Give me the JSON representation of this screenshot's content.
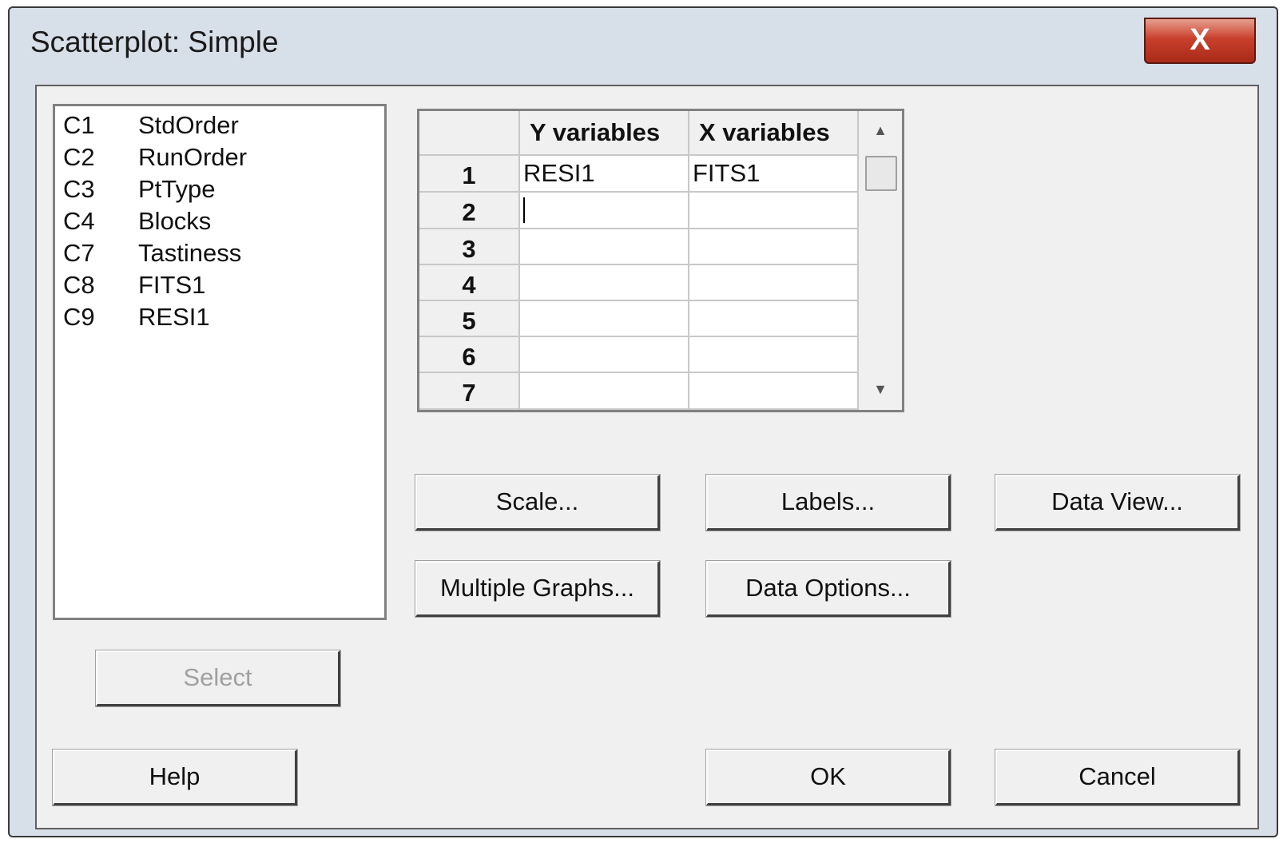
{
  "window": {
    "title": "Scatterplot: Simple",
    "close_label": "X"
  },
  "variables": [
    {
      "col": "C1",
      "name": "StdOrder"
    },
    {
      "col": "C2",
      "name": "RunOrder"
    },
    {
      "col": "C3",
      "name": "PtType"
    },
    {
      "col": "C4",
      "name": "Blocks"
    },
    {
      "col": "C7",
      "name": "Tastiness"
    },
    {
      "col": "C8",
      "name": "FITS1"
    },
    {
      "col": "C9",
      "name": "RESI1"
    }
  ],
  "grid": {
    "headers": [
      "Y variables",
      "X variables"
    ],
    "rows": [
      {
        "num": "1",
        "y": "RESI1",
        "x": "FITS1"
      },
      {
        "num": "2",
        "y": "",
        "x": ""
      },
      {
        "num": "3",
        "y": "",
        "x": ""
      },
      {
        "num": "4",
        "y": "",
        "x": ""
      },
      {
        "num": "5",
        "y": "",
        "x": ""
      },
      {
        "num": "6",
        "y": "",
        "x": ""
      },
      {
        "num": "7",
        "y": "",
        "x": ""
      }
    ]
  },
  "buttons": {
    "scale": "Scale...",
    "labels": "Labels...",
    "data_view": "Data View...",
    "multiple_graphs": "Multiple Graphs...",
    "data_options": "Data Options...",
    "select": "Select",
    "help": "Help",
    "ok": "OK",
    "cancel": "Cancel"
  }
}
